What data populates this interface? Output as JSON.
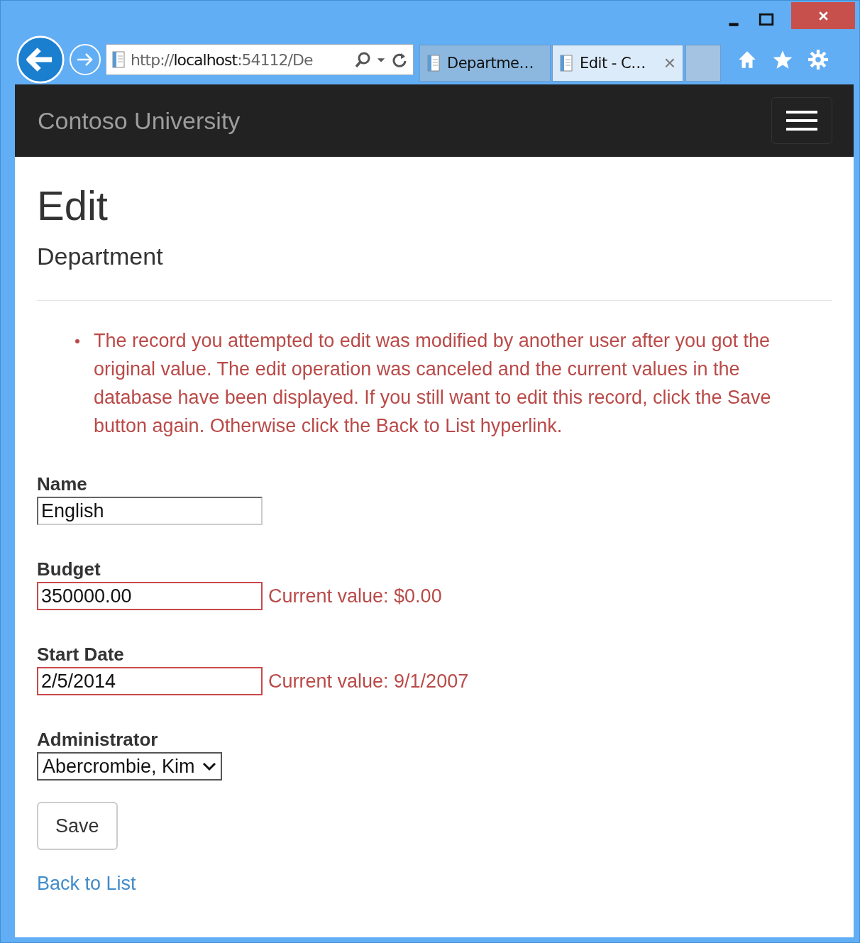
{
  "browser": {
    "address": {
      "url": "http://**localhost**:54112/De"
    },
    "tabs": [
      {
        "title": "Departme…",
        "selected": false
      },
      {
        "title": "Edit - C…",
        "selected": true,
        "close": "×"
      }
    ]
  },
  "navbar": {
    "brand": "Contoso University"
  },
  "page": {
    "title": "Edit",
    "subtitle": "Department",
    "errors": [
      "The record you attempted to edit was modified by another user after you got the original value. The edit operation was canceled and the current values in the database have been displayed. If you still want to edit this record, click the Save button again. Otherwise click the Back to List hyperlink."
    ],
    "fields": [
      {
        "kind": "text",
        "label": "Name",
        "value": "English",
        "error": false
      },
      {
        "kind": "text",
        "label": "Budget",
        "value": "350000.00",
        "error": true,
        "message": "Current value: $0.00"
      },
      {
        "kind": "text",
        "label": "Start Date",
        "value": "2/5/2014",
        "error": true,
        "message": "Current value: 9/1/2007"
      },
      {
        "kind": "select",
        "label": "Administrator",
        "value": "Abercrombie, Kim",
        "error": false
      }
    ],
    "save_button": "Save",
    "back_link": "Back to List"
  }
}
